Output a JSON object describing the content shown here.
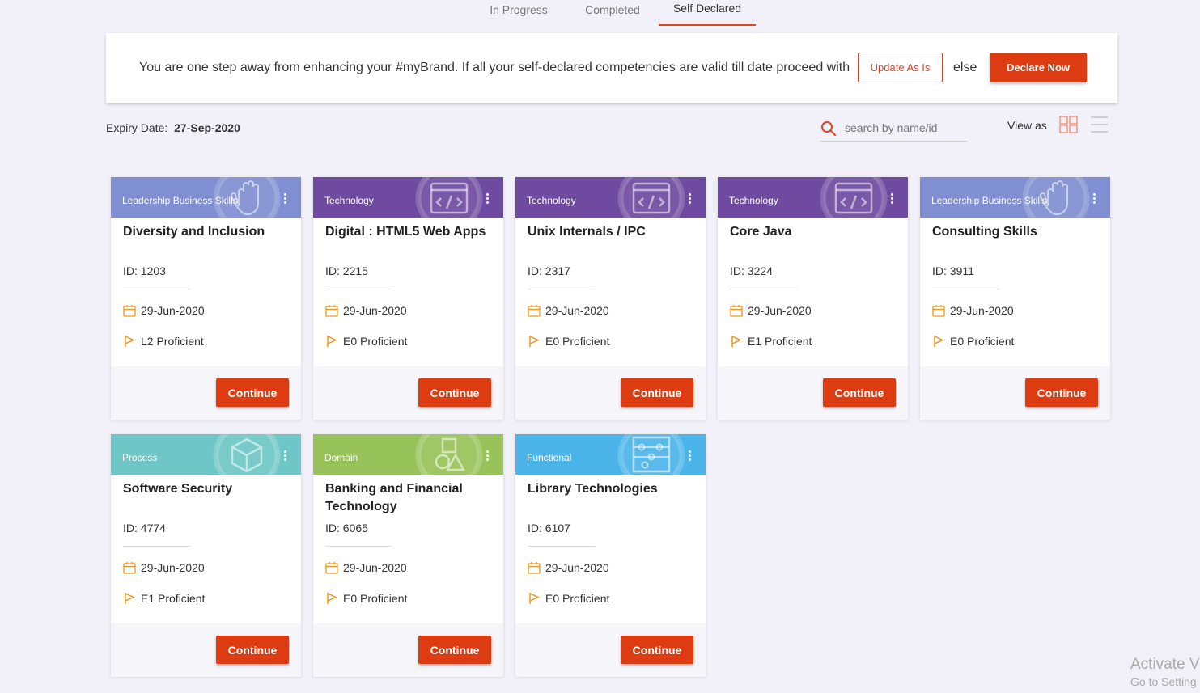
{
  "tabs": [
    {
      "label": "In Progress"
    },
    {
      "label": "Completed"
    },
    {
      "label": "Self Declared"
    }
  ],
  "banner": {
    "text": "You are one step away from enhancing your #myBrand. If all your self-declared competencies are valid till date proceed with",
    "update_label": "Update As Is",
    "else_label": "else",
    "declare_label": "Declare Now"
  },
  "expiry": {
    "label": "Expiry Date:",
    "value": "27-Sep-2020"
  },
  "search": {
    "placeholder": "search by name/id"
  },
  "view": {
    "label": "View as"
  },
  "colors": {
    "accent": "#dd3b12",
    "leadership": "#7f8fd1",
    "technology": "#6e4aa0",
    "process": "#6ec7c6",
    "domain": "#98c35a",
    "functional": "#4bb5ea"
  },
  "cards": [
    {
      "category": "Leadership Business Skills",
      "icon": "hand-icon",
      "title": "Diversity and Inclusion",
      "id": "ID: 1203",
      "date": "29-Jun-2020",
      "level": "L2 Proficient",
      "button": "Continue"
    },
    {
      "category": "Technology",
      "icon": "code-window-icon",
      "title": "Digital : HTML5 Web Apps",
      "id": "ID: 2215",
      "date": "29-Jun-2020",
      "level": "E0 Proficient",
      "button": "Continue"
    },
    {
      "category": "Technology",
      "icon": "code-window-icon",
      "title": "Unix Internals / IPC",
      "id": "ID: 2317",
      "date": "29-Jun-2020",
      "level": "E0 Proficient",
      "button": "Continue"
    },
    {
      "category": "Technology",
      "icon": "code-window-icon",
      "title": "Core Java",
      "id": "ID: 3224",
      "date": "29-Jun-2020",
      "level": "E1 Proficient",
      "button": "Continue"
    },
    {
      "category": "Leadership Business Skills",
      "icon": "hand-icon",
      "title": "Consulting Skills",
      "id": "ID: 3911",
      "date": "29-Jun-2020",
      "level": "E0 Proficient",
      "button": "Continue"
    },
    {
      "category": "Process",
      "icon": "cube-network-icon",
      "title": "Software Security",
      "id": "ID: 4774",
      "date": "29-Jun-2020",
      "level": "E1 Proficient",
      "button": "Continue"
    },
    {
      "category": "Domain",
      "icon": "shapes-blocks-icon",
      "title": "Banking and Financial Technology",
      "id": "ID: 6065",
      "date": "29-Jun-2020",
      "level": "E0 Proficient",
      "button": "Continue"
    },
    {
      "category": "Functional",
      "icon": "abacus-icon",
      "title": "Library Technologies",
      "id": "ID: 6107",
      "date": "29-Jun-2020",
      "level": "E0 Proficient",
      "button": "Continue"
    }
  ],
  "watermark": {
    "line1": "Activate V",
    "line2": "Go to Setting"
  }
}
